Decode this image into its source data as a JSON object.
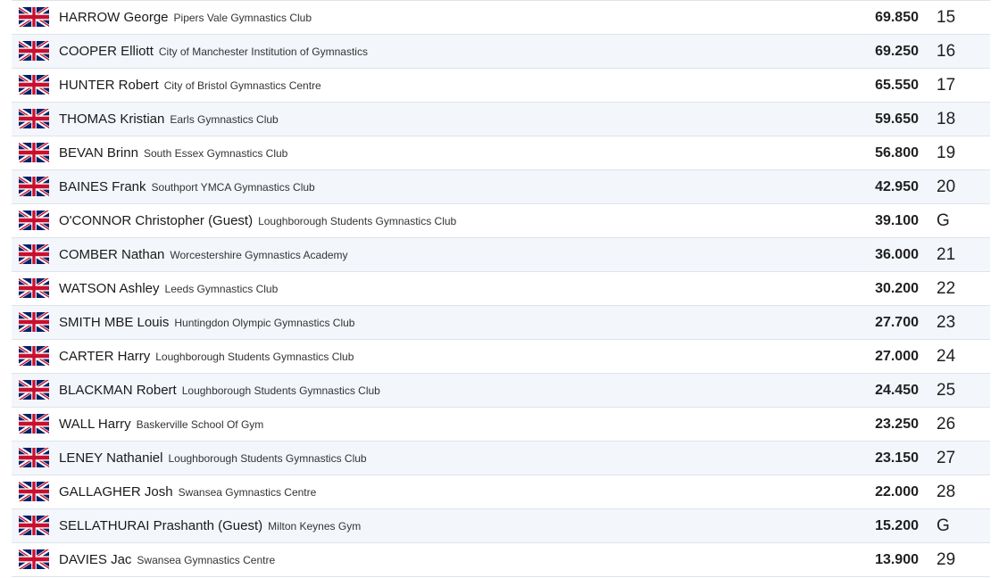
{
  "results": [
    {
      "name": "HARROW George",
      "club": "Pipers Vale Gymnastics Club",
      "score": "69.850",
      "rank": "15",
      "flag": "union-jack-flag"
    },
    {
      "name": "COOPER Elliott",
      "club": "City of Manchester Institution of Gymnastics",
      "score": "69.250",
      "rank": "16",
      "flag": "union-jack-flag"
    },
    {
      "name": "HUNTER Robert",
      "club": "City of Bristol Gymnastics Centre",
      "score": "65.550",
      "rank": "17",
      "flag": "union-jack-flag"
    },
    {
      "name": "THOMAS Kristian",
      "club": "Earls Gymnastics Club",
      "score": "59.650",
      "rank": "18",
      "flag": "union-jack-flag"
    },
    {
      "name": "BEVAN Brinn",
      "club": "South Essex Gymnastics Club",
      "score": "56.800",
      "rank": "19",
      "flag": "union-jack-flag"
    },
    {
      "name": "BAINES Frank",
      "club": "Southport YMCA Gymnastics Club",
      "score": "42.950",
      "rank": "20",
      "flag": "union-jack-flag"
    },
    {
      "name": "O'CONNOR Christopher (Guest)",
      "club": "Loughborough Students Gymnastics Club",
      "score": "39.100",
      "rank": "G",
      "flag": "union-jack-flag"
    },
    {
      "name": "COMBER Nathan",
      "club": "Worcestershire Gymnastics Academy",
      "score": "36.000",
      "rank": "21",
      "flag": "union-jack-flag"
    },
    {
      "name": "WATSON Ashley",
      "club": "Leeds Gymnastics Club",
      "score": "30.200",
      "rank": "22",
      "flag": "union-jack-flag"
    },
    {
      "name": "SMITH MBE Louis",
      "club": "Huntingdon Olympic Gymnastics Club",
      "score": "27.700",
      "rank": "23",
      "flag": "union-jack-flag"
    },
    {
      "name": "CARTER Harry",
      "club": "Loughborough Students Gymnastics Club",
      "score": "27.000",
      "rank": "24",
      "flag": "union-jack-flag"
    },
    {
      "name": "BLACKMAN Robert",
      "club": "Loughborough Students Gymnastics Club",
      "score": "24.450",
      "rank": "25",
      "flag": "union-jack-flag"
    },
    {
      "name": "WALL Harry",
      "club": "Baskerville School Of Gym",
      "score": "23.250",
      "rank": "26",
      "flag": "union-jack-flag"
    },
    {
      "name": "LENEY Nathaniel",
      "club": "Loughborough Students Gymnastics Club",
      "score": "23.150",
      "rank": "27",
      "flag": "union-jack-flag"
    },
    {
      "name": "GALLAGHER Josh",
      "club": "Swansea Gymnastics Centre",
      "score": "22.000",
      "rank": "28",
      "flag": "union-jack-flag"
    },
    {
      "name": "SELLATHURAI Prashanth (Guest)",
      "club": "Milton Keynes Gym",
      "score": "15.200",
      "rank": "G",
      "flag": "union-jack-flag"
    },
    {
      "name": "DAVIES Jac",
      "club": "Swansea Gymnastics Centre",
      "score": "13.900",
      "rank": "29",
      "flag": "union-jack-flag"
    }
  ],
  "colors": {
    "row_alt": "#f3f6fb",
    "row_border": "#dfe3ea",
    "flag_blue": "#012169",
    "flag_red": "#c8102e"
  }
}
